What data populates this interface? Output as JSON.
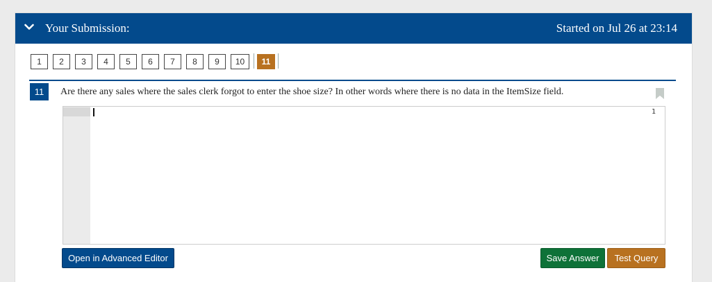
{
  "header": {
    "title": "Your Submission:",
    "started": "Started on Jul 26 at 23:14"
  },
  "question_nav": {
    "items": [
      "1",
      "2",
      "3",
      "4",
      "5",
      "6",
      "7",
      "8",
      "9",
      "10",
      "11"
    ],
    "active": "11"
  },
  "question": {
    "number": "11",
    "text": "Are there any sales where the sales clerk forgot to enter the shoe size? In other words where there is no data in the ItemSize field."
  },
  "editor": {
    "line_numbers": [
      "1"
    ],
    "content": ""
  },
  "buttons": {
    "advanced_editor": "Open in Advanced Editor",
    "save_answer": "Save Answer",
    "test_query": "Test Query"
  },
  "icons": {
    "collapse": "chevron-down-icon",
    "bookmark": "bookmark-icon"
  },
  "colors": {
    "primary": "#034a8c",
    "accent": "#b87120",
    "success": "#0e7238"
  }
}
